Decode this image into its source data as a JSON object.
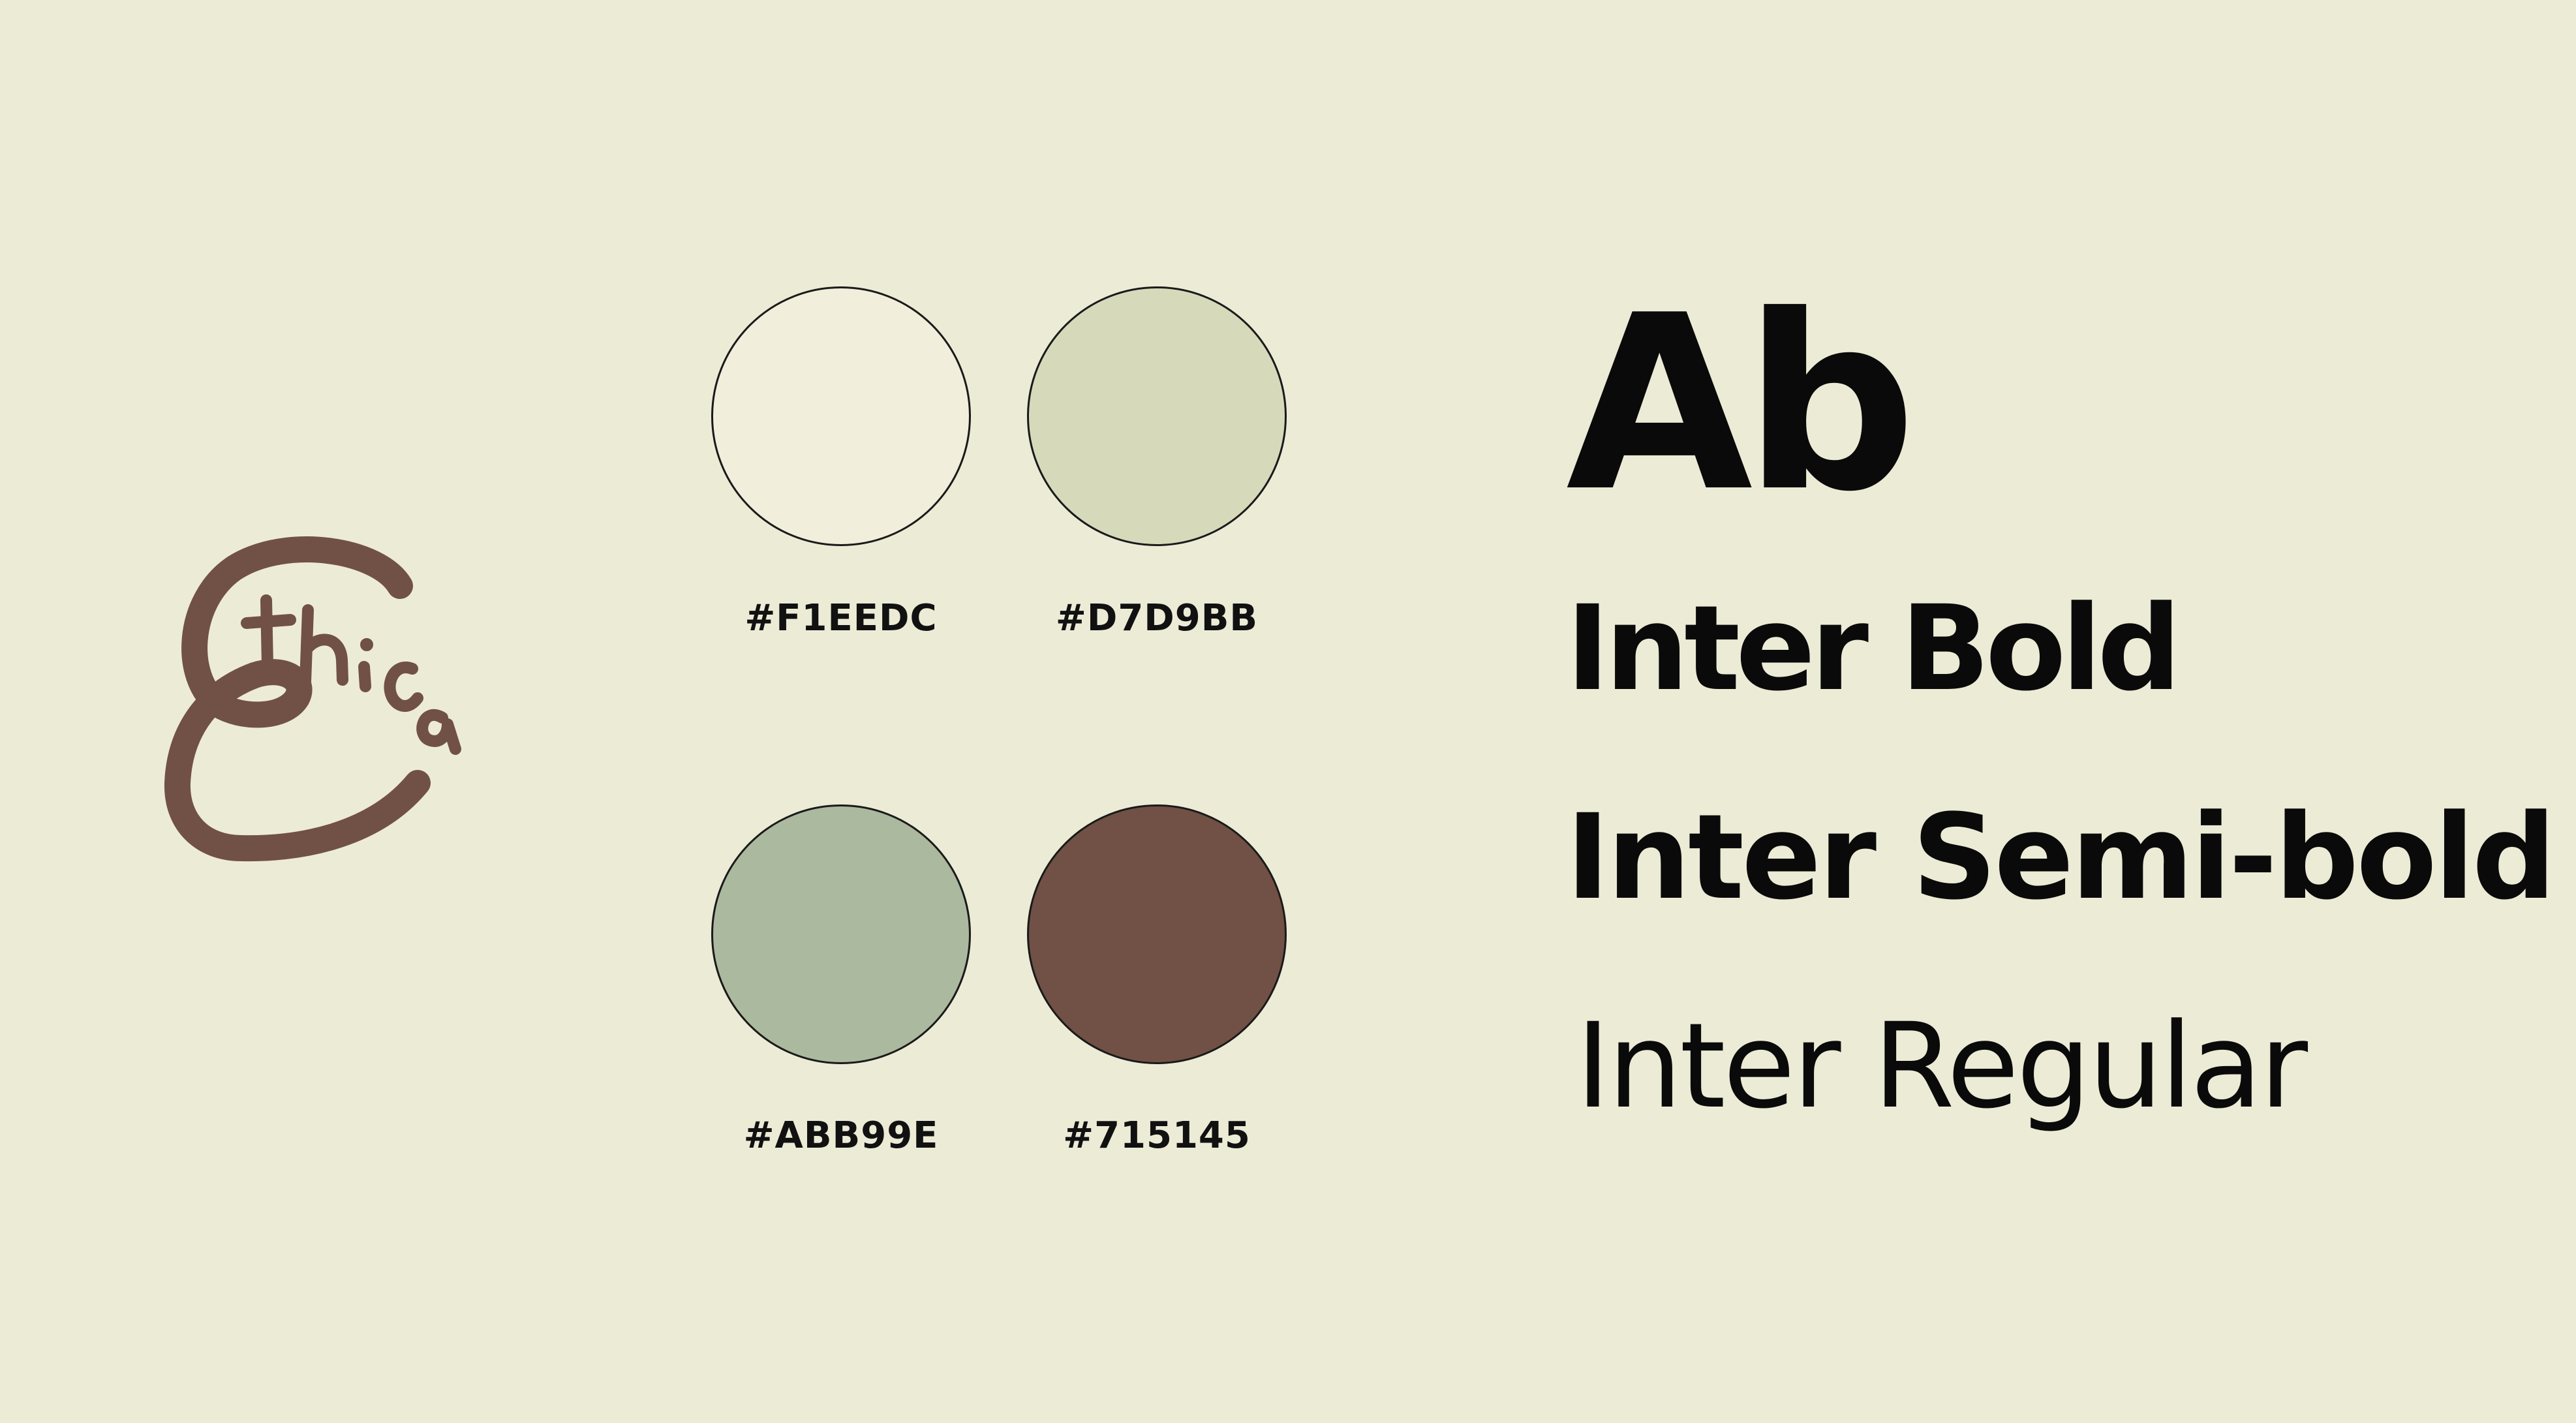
{
  "logo": {
    "text": "Ethica",
    "color": "#715145"
  },
  "palette": {
    "swatches": [
      {
        "label": "#F1EEDC",
        "color": "#F1EEDC"
      },
      {
        "label": "#D7D9BB",
        "color": "#D7D9BB"
      },
      {
        "label": "#ABB99E",
        "color": "#ABB99E"
      },
      {
        "label": "#715145",
        "color": "#715145"
      }
    ]
  },
  "typography": {
    "sample": "Ab",
    "styles": [
      "Inter Bold",
      "Inter Semi-bold",
      "Inter Regular"
    ]
  },
  "colors": {
    "background": "#ECEBD6",
    "outline": "#1A1A1A",
    "text": "#111111"
  }
}
